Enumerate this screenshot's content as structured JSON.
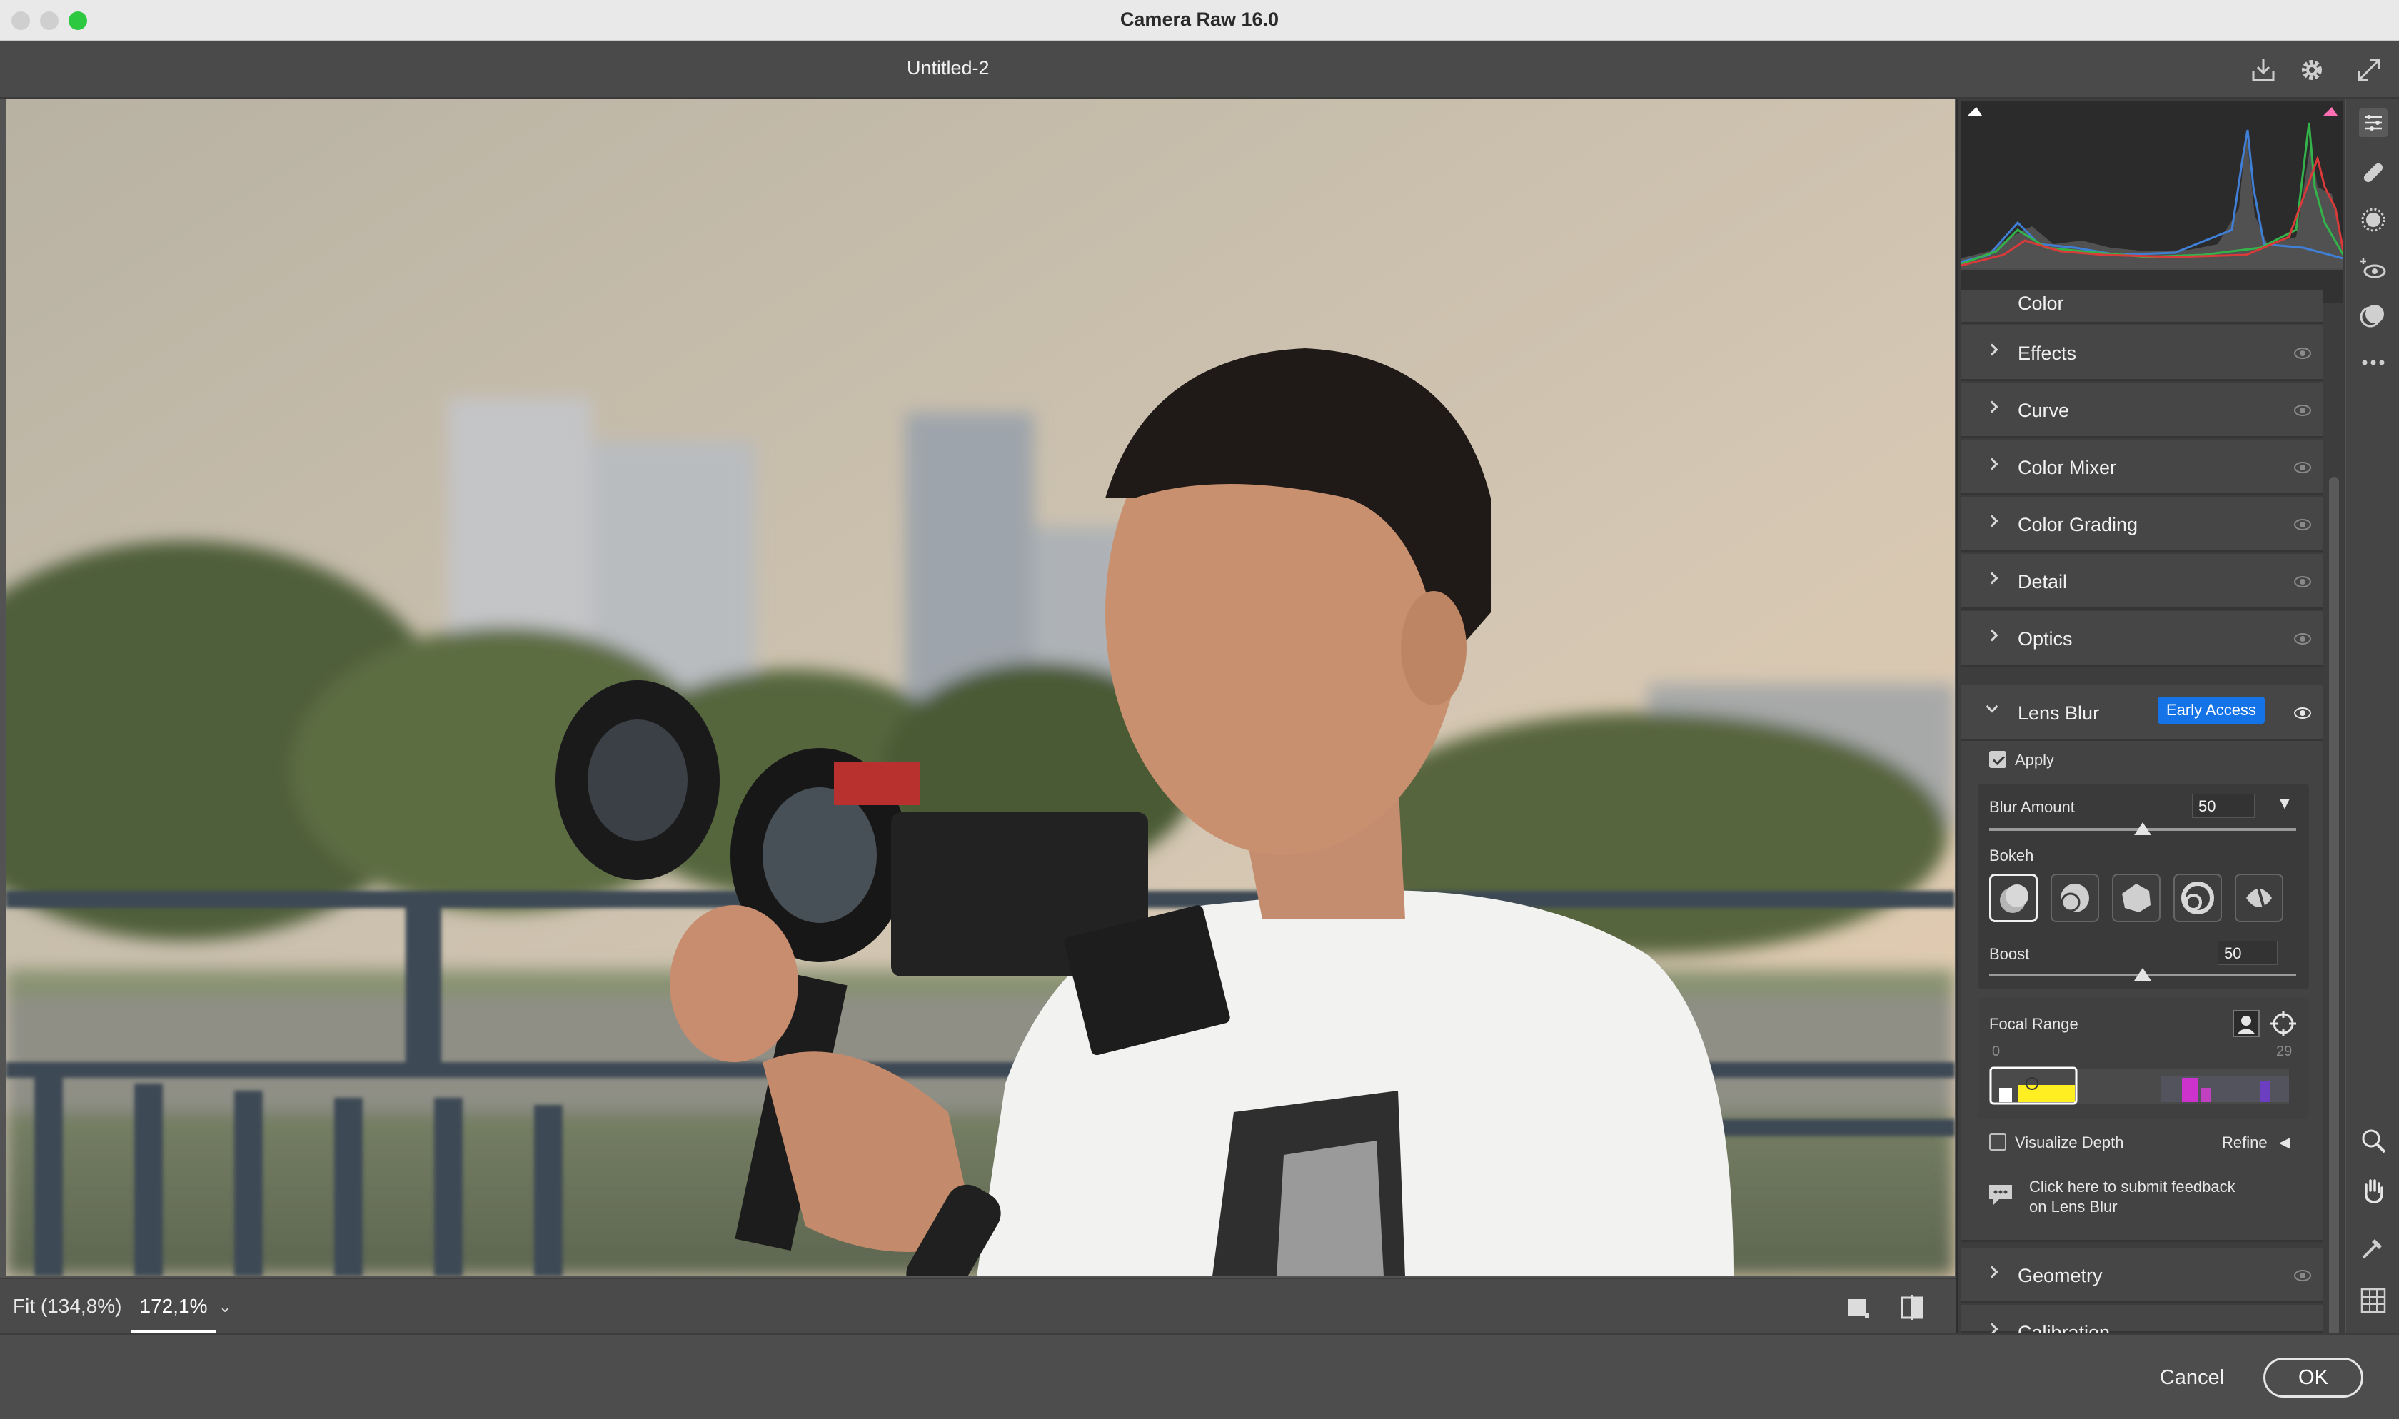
{
  "window": {
    "title": "Camera Raw 16.0"
  },
  "document": {
    "title": "Untitled-2"
  },
  "header_icons": [
    "save-icon",
    "gear-icon",
    "fullscreen-icon"
  ],
  "zoom": {
    "fit_label": "Fit (134,8%)",
    "current": "172,1%"
  },
  "panel": {
    "sections": [
      {
        "label": "Color",
        "expanded": false
      },
      {
        "label": "Effects",
        "expanded": false
      },
      {
        "label": "Curve",
        "expanded": false
      },
      {
        "label": "Color Mixer",
        "expanded": false
      },
      {
        "label": "Color Grading",
        "expanded": false
      },
      {
        "label": "Detail",
        "expanded": false
      },
      {
        "label": "Optics",
        "expanded": false
      },
      {
        "label": "Geometry",
        "expanded": false
      },
      {
        "label": "Calibration",
        "expanded": false
      }
    ],
    "lens_blur": {
      "label": "Lens Blur",
      "badge": "Early Access",
      "apply_label": "Apply",
      "apply_checked": true,
      "blur_amount_label": "Blur Amount",
      "blur_amount_value": "50",
      "bokeh_label": "Bokeh",
      "bokeh_options": [
        "circle-bokeh-icon",
        "bubble-bokeh-icon",
        "bladed-bokeh-icon",
        "ring-bokeh-icon",
        "cat-eye-bokeh-icon"
      ],
      "boost_label": "Boost",
      "boost_value": "50",
      "focal_range_label": "Focal Range",
      "focal_min": "0",
      "focal_max": "29",
      "visualize_depth_label": "Visualize Depth",
      "visualize_depth_checked": false,
      "refine_label": "Refine",
      "feedback_text_line1": "Click here to submit feedback",
      "feedback_text_line2": "on Lens Blur"
    }
  },
  "tools": [
    "edit-icon",
    "healing-icon",
    "mask-icon",
    "red-eye-icon",
    "presets-icon",
    "more-icon",
    "zoom-icon",
    "hand-icon",
    "sampler-icon",
    "grid-icon"
  ],
  "footer": {
    "cancel_label": "Cancel",
    "ok_label": "OK"
  },
  "colors": {
    "accent": "#1473e6",
    "panel_bg": "#3d3d3d",
    "section_bg": "#464646"
  }
}
